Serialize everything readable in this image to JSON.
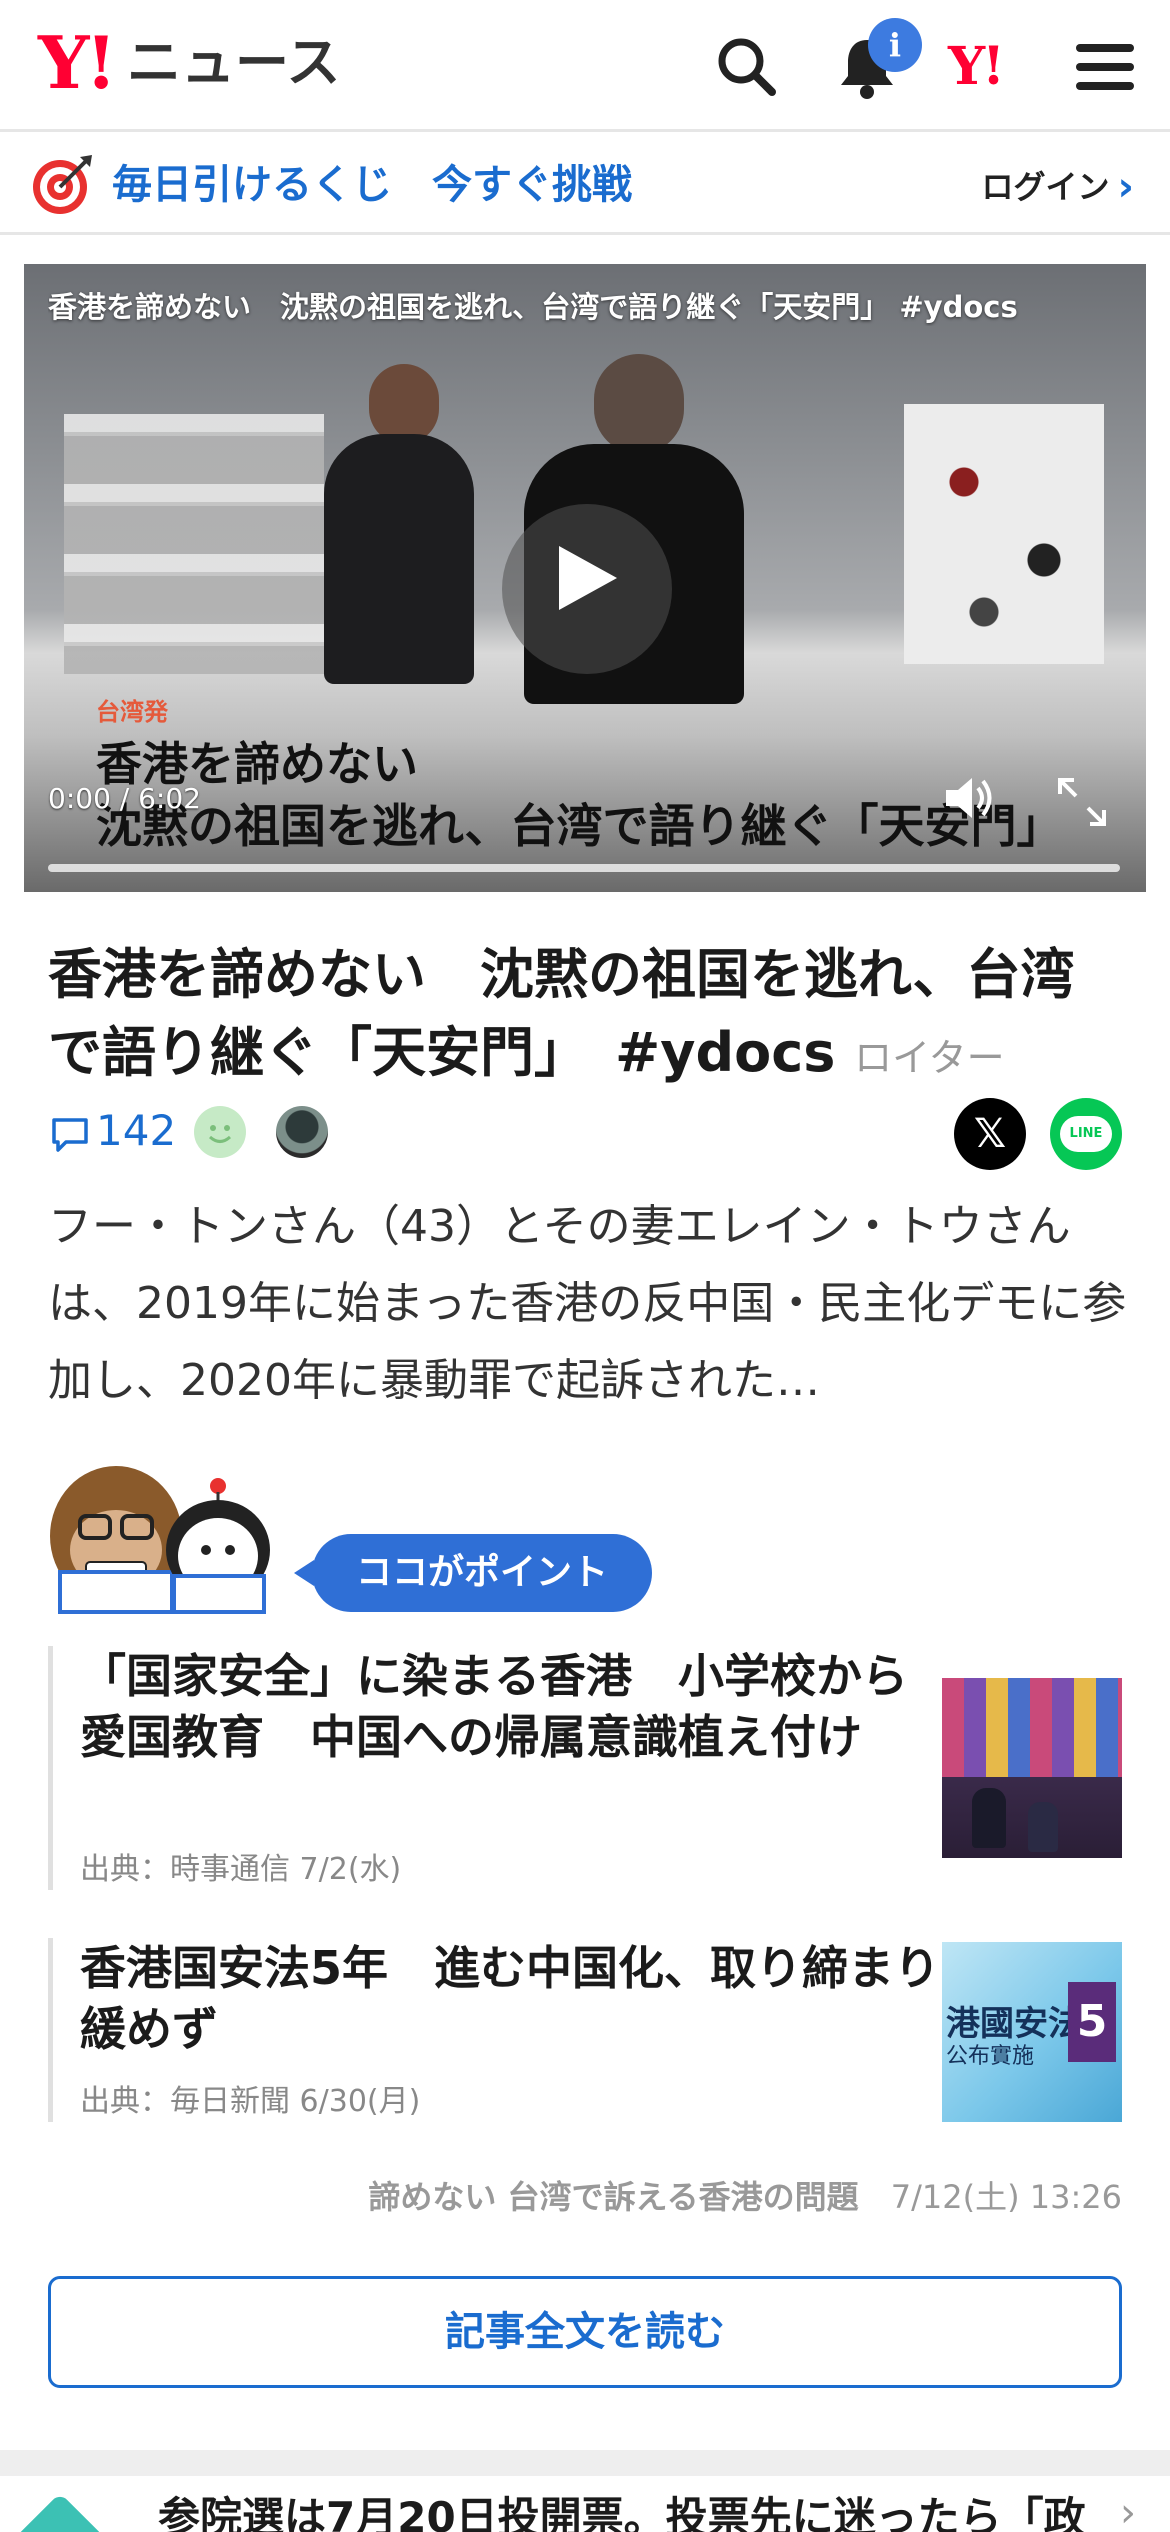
{
  "header": {
    "logo_mark": "Y!",
    "logo_text": "ニュース",
    "notification_badge": "i",
    "yahoo_mark": "Y!"
  },
  "promo": {
    "text": "毎日引けるくじ　今すぐ挑戦",
    "login_label": "ログイン",
    "login_chevron": "›"
  },
  "video": {
    "title": "香港を諦めない　沈黙の祖国を逃れ、台湾で語り継ぐ「天安門」 #ydocs",
    "caption_tag": "台湾発",
    "caption_line1": "香港を諦めない",
    "caption_line2": "沈黙の祖国を逃れ、台湾で語り継ぐ「天安門」",
    "time": "0:00 / 6:02",
    "progress": 0
  },
  "article": {
    "headline": "香港を諦めない　沈黙の祖国を逃れ、台湾で語り継ぐ「天安門」　#ydocs",
    "source": "ロイター",
    "comment_count": "142",
    "share_x": "𝕏",
    "share_line": "LINE",
    "lead": "フー・トンさん（43）とその妻エレイン・トウさんは、2019年に始まった香港の反中国・民主化デモに参加し、2020年に暴動罪で起訴された…"
  },
  "point": {
    "label": "ココがポイント",
    "items": [
      {
        "title": "「国家安全」に染まる香港　小学校から愛国教育　中国への帰属意識植え付け",
        "source": "出典：時事通信 7/2(水)"
      },
      {
        "title": "香港国安法5年　進む中国化、取り締まり緩めず",
        "source": "出典：毎日新聞 6/30(月)",
        "thumb_text": "港國安法",
        "thumb_sub": "公布實施",
        "thumb_num": "5"
      }
    ]
  },
  "byline": {
    "title": "諦めない 台湾で訴える香港の問題",
    "date": "7/12(土) 13:26"
  },
  "read_more": "記事全文を読む",
  "teaser": {
    "text": "参院選は7月20日投開票。投票先に迷ったら「政",
    "chevron": "›"
  },
  "colors": {
    "brand_red": "#ff0033",
    "link_blue": "#1a6ccf",
    "badge_blue": "#3d7be0",
    "pill_blue": "#2f6fd6",
    "line_green": "#06c755"
  }
}
